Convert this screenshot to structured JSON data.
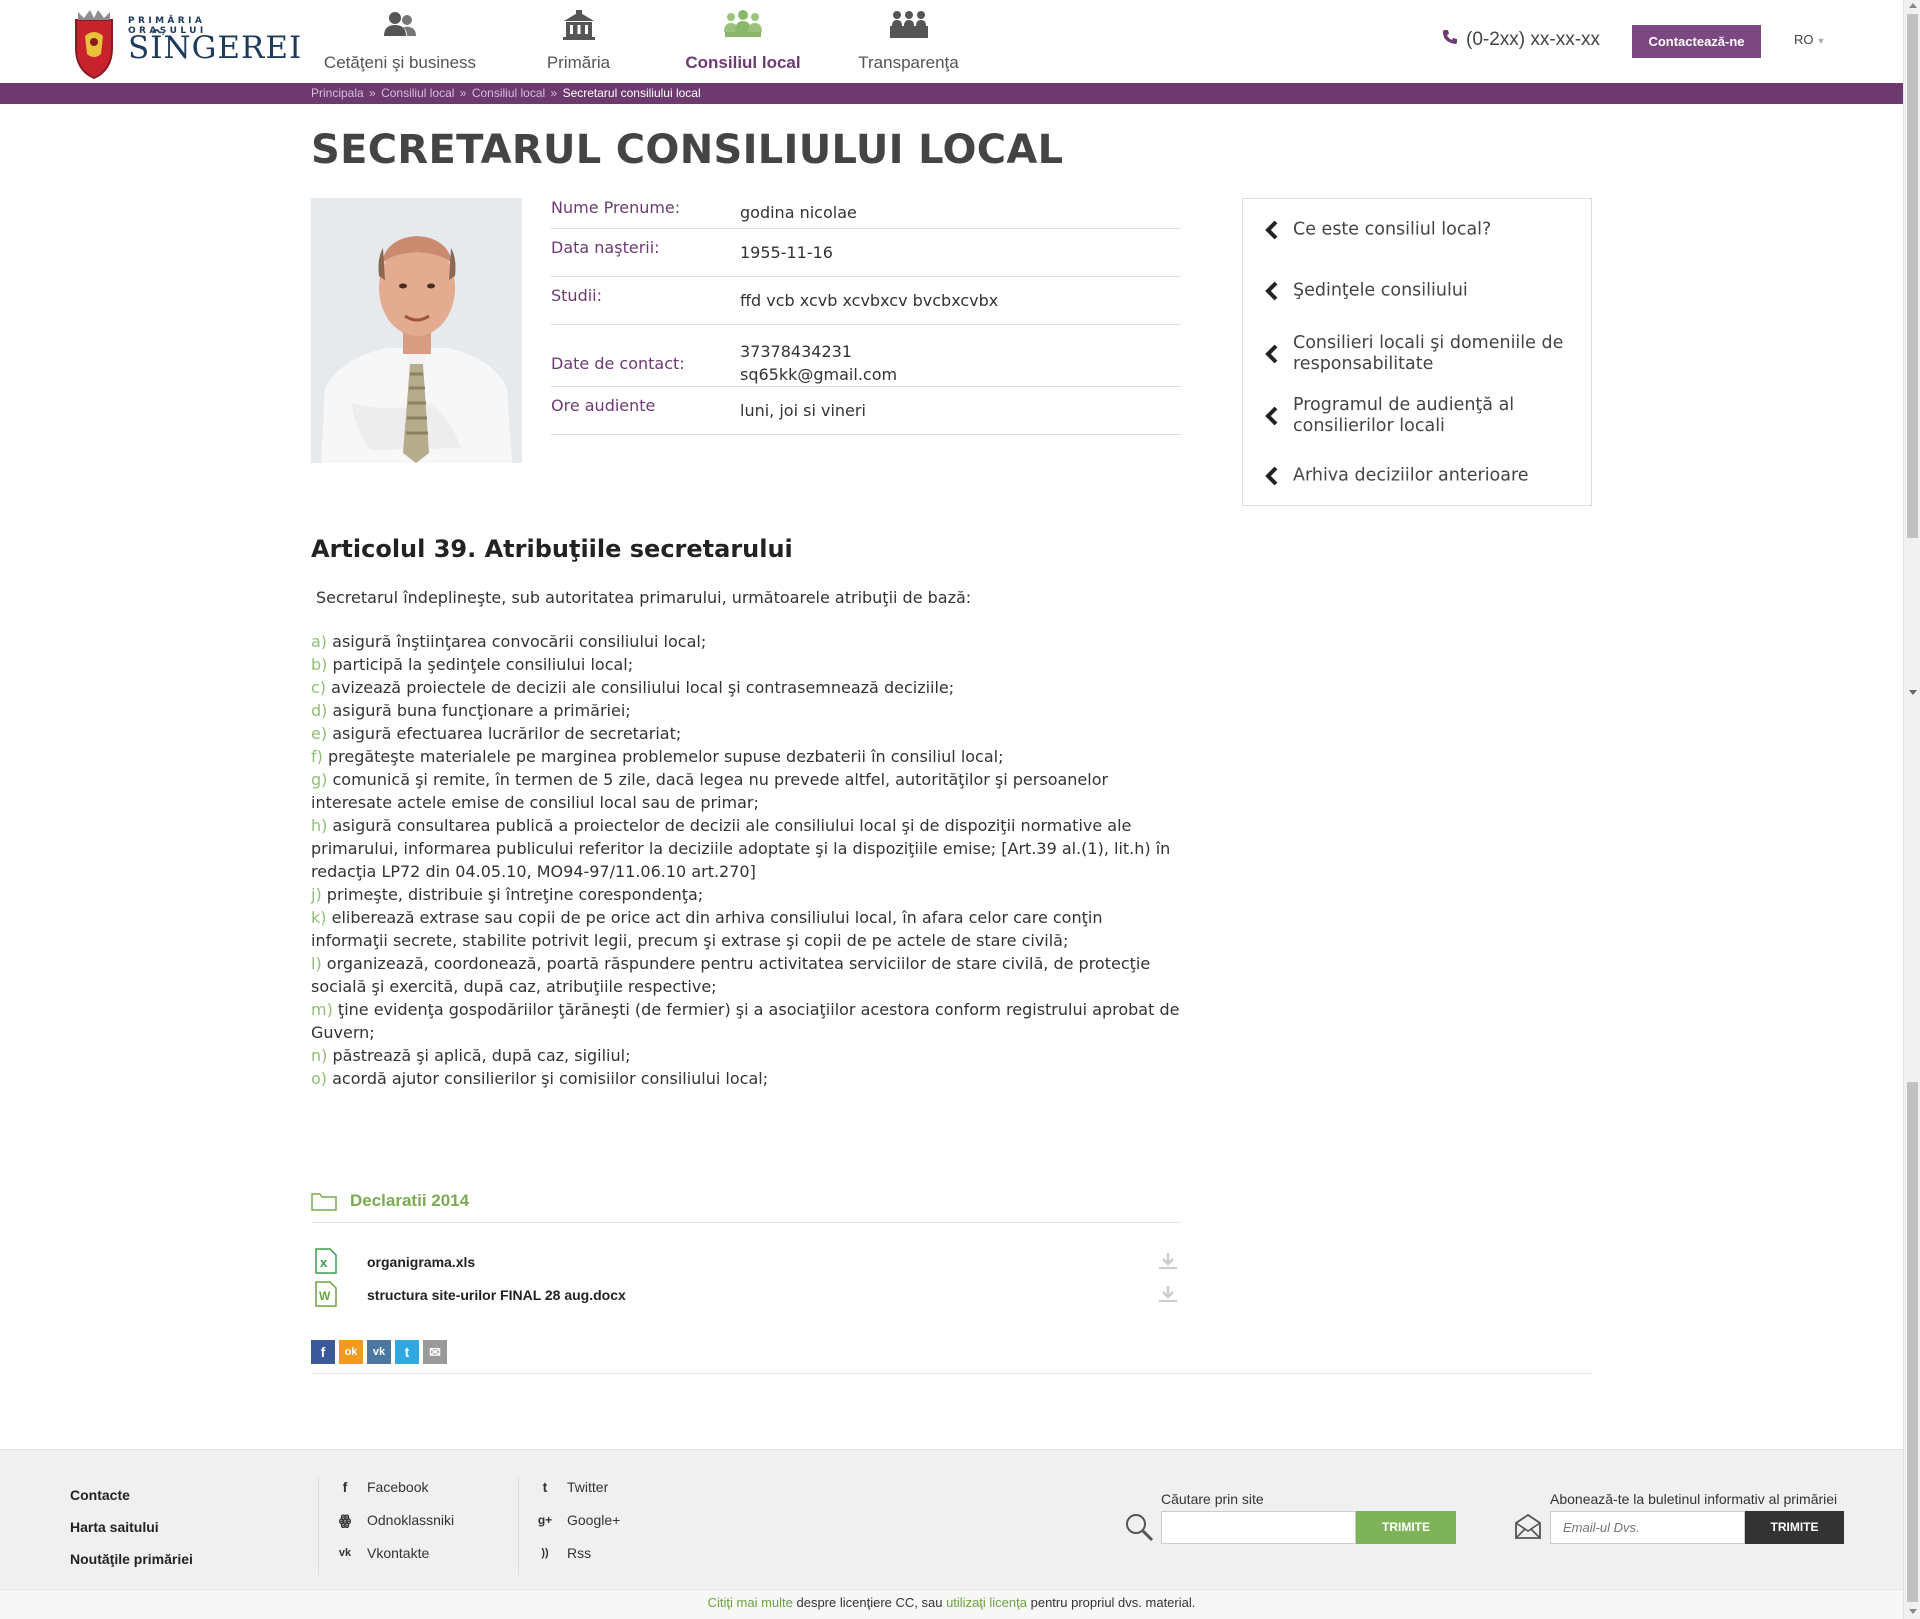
{
  "header": {
    "logo_small": "PRIMĂRIA ORAŞULUI",
    "logo_big": "SÎNGEREI",
    "nav": [
      {
        "label": "Cetăţeni şi business",
        "icon": "people-icon"
      },
      {
        "label": "Primăria",
        "icon": "building-icon"
      },
      {
        "label": "Consiliul local",
        "icon": "council-icon",
        "active": true
      },
      {
        "label": "Transparenţa",
        "icon": "meeting-icon"
      }
    ],
    "phone": "(0-2xx) xx-xx-xx",
    "contact_label": "Contactează-ne",
    "lang": "RO"
  },
  "breadcrumb": {
    "items": [
      "Principala",
      "Consiliul local",
      "Consiliul local"
    ],
    "current": "Secretarul consiliului local",
    "sep": "»"
  },
  "page": {
    "title": "SECRETARUL CONSILIULUI LOCAL"
  },
  "profile": {
    "rows": [
      {
        "key": "Nume Prenume:",
        "value": "godina nicolae"
      },
      {
        "key": "Data naşterii:",
        "value": "1955-11-16"
      },
      {
        "key": "Studii:",
        "value": "ffd vcb xcvb xcvbxcv bvcbxcvbx"
      },
      {
        "key": "Date de contact:",
        "value": "37378434231",
        "value2": "sq65kk@gmail.com"
      },
      {
        "key": "Ore audiente",
        "value": "luni, joi si vineri"
      }
    ]
  },
  "sidebar": {
    "items": [
      "Ce este consiliul local?",
      "Şedinţele consiliului",
      "Consilieri locali şi domeniile de responsabilitate",
      "Programul de audienţă al consilierilor locali",
      "Arhiva deciziilor anterioare"
    ]
  },
  "article": {
    "heading": "Articolul 39. Atribuţiile secretarului",
    "intro": "Secretarul îndeplineşte, sub autoritatea primarului, următoarele atribuţii de bază:",
    "items": [
      {
        "letter": "a)",
        "text": "asigură înştiinţarea convocării consiliului local;"
      },
      {
        "letter": "b)",
        "text": "participă la şedinţele consiliului local;"
      },
      {
        "letter": "c)",
        "text": "avizează proiectele de decizii ale consiliului local şi contrasemnează deciziile;"
      },
      {
        "letter": "d)",
        "text": "asigură buna funcţionare a primăriei;"
      },
      {
        "letter": "e)",
        "text": " asigură efectuarea lucrărilor de secretariat;"
      },
      {
        "letter": "f)",
        "text": "pregăteşte materialele pe marginea problemelor supuse dezbaterii în consiliul local;"
      },
      {
        "letter": "g)",
        "text": "comunică şi remite, în termen de 5 zile, dacă legea nu prevede altfel, autorităţilor şi persoanelor interesate actele emise de consiliul local sau de primar;"
      },
      {
        "letter": "h)",
        "text": "asigură consultarea publică a proiectelor de decizii ale consiliului local şi de dispoziţii normative ale primarului, informarea publicului referitor la deciziile adoptate şi la dispoziţiile emise; [Art.39 al.(1), lit.h) în redacţia LP72 din 04.05.10,  MO94-97/11.06.10 art.270]"
      },
      {
        "letter": "j)",
        "text": "primeşte, distribuie şi întreţine corespondenţa;"
      },
      {
        "letter": "k)",
        "text": "eliberează extrase sau copii de pe orice act din arhiva consiliului local, în afara celor care conţin informaţii secrete, stabilite potrivit legii, precum şi extrase şi copii de pe actele de stare civilă;"
      },
      {
        "letter": "l)",
        "text": "organizează, coordonează, poartă răspundere pentru activitatea serviciilor de stare civilă, de protecţie socială şi exercită, după caz, atribuţiile respective;"
      },
      {
        "letter": "m)",
        "text": "ţine evidenţa gospodăriilor ţărăneşti (de fermier) şi a asociaţiilor acestora conform registrului aprobat de Guvern;"
      },
      {
        "letter": "n)",
        "text": "păstrează şi aplică, după caz, sigiliul;"
      },
      {
        "letter": "o)",
        "text": "acordă ajutor consilierilor şi comisiilor consiliului local;"
      }
    ]
  },
  "declarations": {
    "folder": "Declaratii 2014",
    "files": [
      {
        "name": "organigrama.xls",
        "type": "xls"
      },
      {
        "name": "structura site-urilor FINAL 28 aug.docx",
        "type": "docx"
      }
    ]
  },
  "share": [
    {
      "name": "facebook",
      "glyph": "f",
      "color": "#3b5998"
    },
    {
      "name": "odnoklassniki",
      "glyph": "ok",
      "color": "#f59a1c"
    },
    {
      "name": "vkontakte",
      "glyph": "vk",
      "color": "#4d76a1"
    },
    {
      "name": "twitter",
      "glyph": "t",
      "color": "#2fa8e1"
    },
    {
      "name": "email",
      "glyph": "✉",
      "color": "#999999"
    }
  ],
  "footer": {
    "links": [
      "Contacte",
      "Harta saitului",
      "Noutăţile primăriei"
    ],
    "social_col1": [
      {
        "label": "Facebook",
        "glyph": "f"
      },
      {
        "label": "Odnoklassniki",
        "glyph": "ꙮ"
      },
      {
        "label": "Vkontakte",
        "glyph": "vk"
      }
    ],
    "social_col2": [
      {
        "label": "Twitter",
        "glyph": "t"
      },
      {
        "label": "Google+",
        "glyph": "g+"
      },
      {
        "label": "Rss",
        "glyph": "))"
      }
    ],
    "search_label": "Căutare prin site",
    "search_button": "TRIMITE",
    "newsletter_label": "Abonează-te la buletinul informativ al primăriei",
    "newsletter_placeholder": "Email-ul Dvs.",
    "newsletter_button": "TRIMITE",
    "license_prefix": "Citiţi mai multe",
    "license_mid": " despre licenţiere CC, sau ",
    "license_link": "utilizaţi licenţa",
    "license_suffix": " pentru propriul dvs. material."
  }
}
